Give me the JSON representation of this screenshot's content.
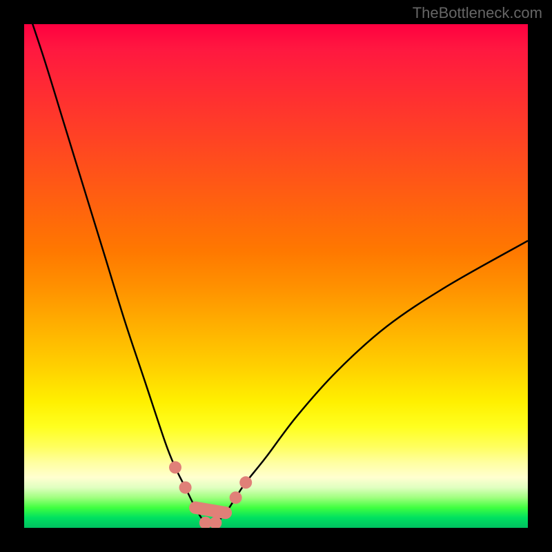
{
  "watermark": "TheBottleneck.com",
  "chart_data": {
    "type": "line",
    "title": "",
    "xlabel": "",
    "ylabel": "",
    "xlim": [
      0,
      100
    ],
    "ylim": [
      0,
      100
    ],
    "curve_description": "V-shaped bottleneck curve plunging from top-left to a broad minimum near x≈37 then rising to the right edge at roughly half height",
    "minimum_x": 37,
    "x": [
      0,
      4,
      8,
      12,
      16,
      20,
      24,
      28,
      30,
      32,
      34,
      36,
      38,
      40,
      42,
      44,
      48,
      54,
      62,
      72,
      84,
      100
    ],
    "y": [
      105,
      93,
      80,
      67,
      54,
      41,
      29,
      17,
      12,
      8,
      4,
      1,
      1,
      3,
      6,
      9,
      14,
      22,
      31,
      40,
      48,
      57
    ],
    "marker_points_x": [
      30,
      32,
      34,
      36,
      38,
      40,
      42,
      44
    ],
    "marker_points_y": [
      12,
      8,
      4,
      1,
      1,
      3,
      6,
      9
    ],
    "colors": {
      "curve": "#000000",
      "markers": "#e08078",
      "gradient_top": "#ff0040",
      "gradient_bottom": "#00c060"
    }
  }
}
